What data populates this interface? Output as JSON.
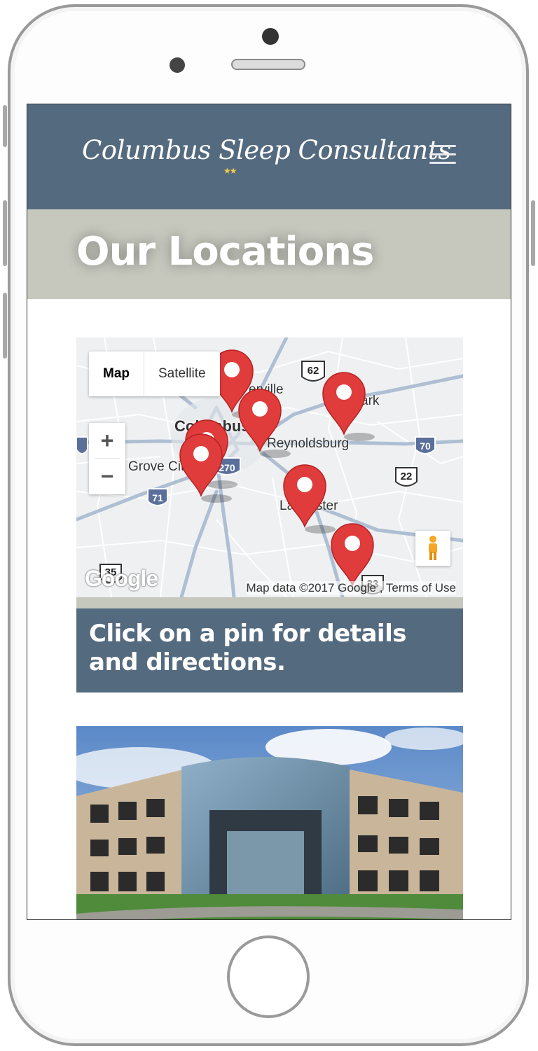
{
  "header": {
    "logo_text": "Columbus Sleep Consultants",
    "logo_stars": "★★",
    "menu_icon": "hamburger-menu-icon"
  },
  "page": {
    "title": "Our Locations"
  },
  "map": {
    "type_controls": {
      "map_label": "Map",
      "satellite_label": "Satellite",
      "selected": "Map"
    },
    "zoom": {
      "in_label": "+",
      "out_label": "−"
    },
    "place_labels": {
      "westerville": "erville",
      "columbus": "Columbus",
      "reynoldsburg": "Reynoldsburg",
      "grove_city": "Grove City",
      "newark": "ark",
      "lancaster": "Lancaster"
    },
    "highway_shields": {
      "us62": "62",
      "i270": "270",
      "i70": "70",
      "i71": "71",
      "us22": "22",
      "us35": "35",
      "us33": "33"
    },
    "google_logo": "Google",
    "attribution": "Map data ©2017 Google , Terms of Use",
    "pin_count": 7,
    "pin_color": "#e03c3c",
    "pegman_icon": "pegman-icon"
  },
  "cta": {
    "text": "Click on a pin for details and directions."
  },
  "colors": {
    "header_bg": "#546a7f",
    "title_band_bg": "#c6c8be",
    "cta_bg": "#546a7f"
  }
}
